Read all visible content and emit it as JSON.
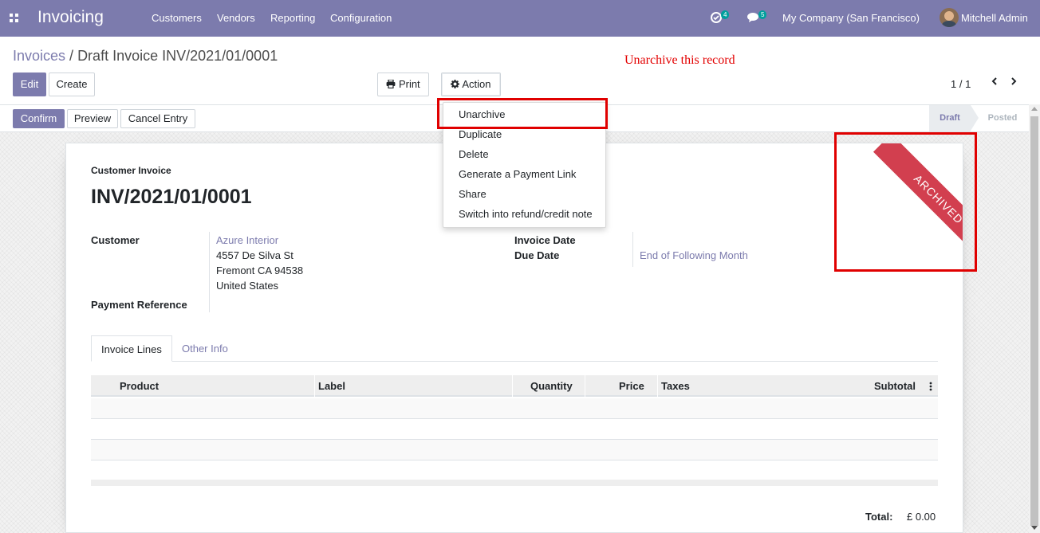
{
  "navbar": {
    "app_name": "Invoicing",
    "menu": [
      "Customers",
      "Vendors",
      "Reporting",
      "Configuration"
    ],
    "activity_count": "4",
    "message_count": "5",
    "company": "My Company (San Francisco)",
    "user": "Mitchell Admin"
  },
  "breadcrumb": {
    "parent": "Invoices",
    "separator": " / ",
    "current": "Draft Invoice INV/2021/01/0001"
  },
  "buttons": {
    "edit": "Edit",
    "create": "Create",
    "print": "Print",
    "action": "Action",
    "confirm": "Confirm",
    "preview": "Preview",
    "cancel_entry": "Cancel Entry"
  },
  "pager": {
    "value": "1 / 1"
  },
  "annotation": "Unarchive this record",
  "status": {
    "stages": [
      "Draft",
      "Posted"
    ],
    "current": "Draft"
  },
  "action_menu": {
    "items": [
      "Unarchive",
      "Duplicate",
      "Delete",
      "Generate a Payment Link",
      "Share",
      "Switch into refund/credit note"
    ],
    "highlighted": "Unarchive"
  },
  "sheet": {
    "type_label": "Customer Invoice",
    "number": "INV/2021/01/0001",
    "ribbon": "ARCHIVED",
    "customer_label": "Customer",
    "customer_name": "Azure Interior",
    "address_line1": "4557 De Silva St",
    "address_line2": "Fremont CA 94538",
    "address_line3": "United States",
    "payment_reference_label": "Payment Reference",
    "invoice_date_label": "Invoice Date",
    "due_date_label": "Due Date",
    "due_date_value": "End of Following Month"
  },
  "tabs": [
    "Invoice Lines",
    "Other Info"
  ],
  "table": {
    "columns": [
      "Product",
      "Label",
      "Quantity",
      "Price",
      "Taxes",
      "Subtotal"
    ],
    "rows": [
      [],
      [],
      [],
      []
    ]
  },
  "totals": {
    "label": "Total:",
    "value": "£ 0.00"
  },
  "colors": {
    "brand": "#7C7BAD",
    "ribbon": "#D23F4F",
    "highlight": "#e00000",
    "annotation": "#e30000"
  }
}
